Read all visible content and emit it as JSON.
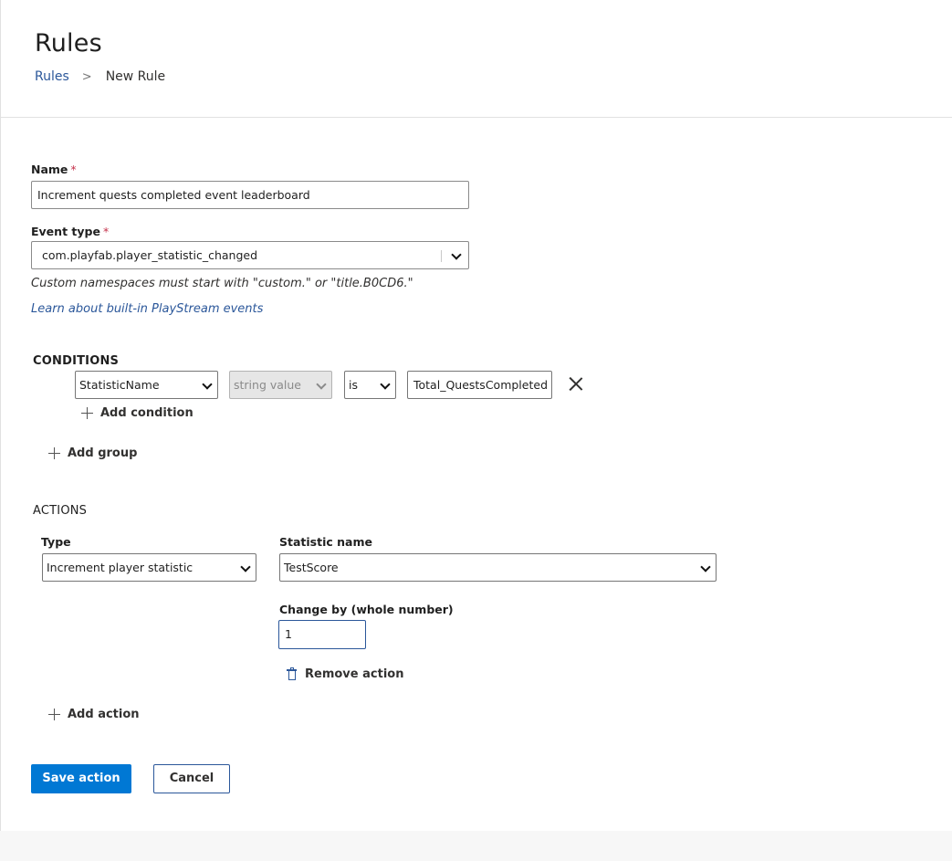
{
  "header": {
    "title": "Rules",
    "breadcrumb": {
      "link": "Rules",
      "separator": ">",
      "current": "New Rule"
    }
  },
  "form": {
    "name": {
      "label": "Name",
      "required_mark": "*",
      "value": "Increment quests completed event leaderboard"
    },
    "event_type": {
      "label": "Event type",
      "required_mark": "*",
      "value": "com.playfab.player_statistic_changed"
    },
    "hint": "Custom namespaces must start with \"custom.\" or \"title.B0CD6.\"",
    "learn_link": "Learn about built-in PlayStream events"
  },
  "conditions": {
    "heading": "CONDITIONS",
    "row": {
      "field": "StatisticName",
      "value_type": "string value",
      "operator": "is",
      "value": "Total_QuestsCompleted"
    },
    "add_condition": "Add condition",
    "add_group": "Add group"
  },
  "actions": {
    "heading": "ACTIONS",
    "type_label": "Type",
    "type_value": "Increment player statistic",
    "statistic_label": "Statistic name",
    "statistic_value": "TestScore",
    "change_label": "Change by (whole number)",
    "change_value": "1",
    "remove_action": "Remove action",
    "add_action": "Add action"
  },
  "footer": {
    "save": "Save action",
    "cancel": "Cancel"
  },
  "colors": {
    "primary": "#0078d4",
    "link": "#2b579a",
    "required": "#c4314b"
  },
  "icons": [
    "chevron-right-icon",
    "chevron-down-icon",
    "plus-icon",
    "close-icon",
    "trash-icon"
  ]
}
